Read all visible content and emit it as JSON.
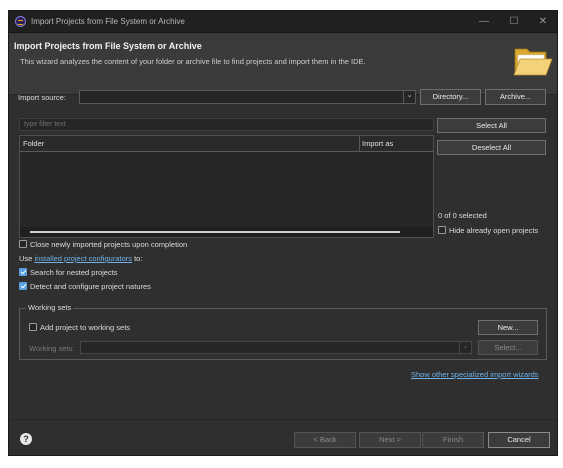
{
  "window": {
    "title": "Import Projects from File System or Archive",
    "minimize": "—",
    "maximize": "☐",
    "close": "✕"
  },
  "header": {
    "title": "Import Projects from File System or Archive",
    "description": "This wizard analyzes the content of your folder or archive file to find projects and import them in the IDE."
  },
  "import_source": {
    "label": "Import source:",
    "value": "",
    "directory_button": "Directory...",
    "archive_button": "Archive..."
  },
  "filter": {
    "placeholder": "type filter text"
  },
  "table": {
    "columns": [
      "Folder",
      "Import as"
    ],
    "rows": []
  },
  "selection": {
    "select_all": "Select All",
    "deselect_all": "Deselect All",
    "count_text": "0 of 0 selected",
    "hide_open_label": "Hide already open projects",
    "hide_open_checked": false
  },
  "options": {
    "close_projects_label": "Close newly imported projects upon completion",
    "close_projects_checked": false,
    "use_prefix": "Use",
    "configurators_link": "installed project configurators",
    "use_suffix": "to:",
    "search_nested_label": "Search for nested projects",
    "search_nested_checked": true,
    "detect_natures_label": "Detect and configure project natures",
    "detect_natures_checked": true
  },
  "working_sets": {
    "group_label": "Working sets",
    "add_label": "Add project to working sets",
    "add_checked": false,
    "new_button": "New...",
    "sets_label": "Working sets:",
    "sets_value": "",
    "select_button": "Select..."
  },
  "other_wizards_link": "Show other specialized import wizards",
  "footer": {
    "help_icon": "?",
    "back": "< Back",
    "next": "Next >",
    "finish": "Finish",
    "cancel": "Cancel"
  },
  "colors": {
    "background": "#2f2f2f",
    "titlebar": "#202020",
    "header": "#3a3a3a",
    "link": "#6fb3ea",
    "checkbox_checked": "#5aa0e0"
  }
}
